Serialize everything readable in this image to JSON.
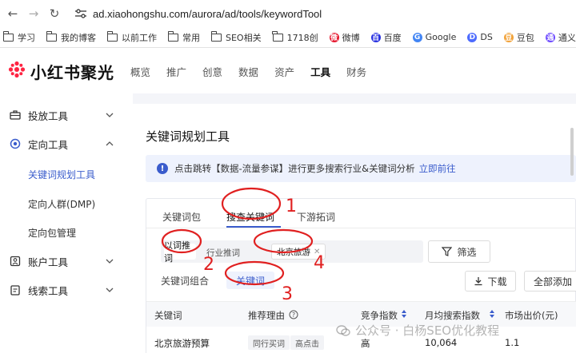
{
  "browser": {
    "url": "ad.xiaohongshu.com/aurora/ad/tools/keywordTool"
  },
  "bookmarks": [
    {
      "label": "学习",
      "icon": "folder-icon"
    },
    {
      "label": "我的博客",
      "icon": "folder-icon"
    },
    {
      "label": "以前工作",
      "icon": "folder-icon"
    },
    {
      "label": "常用",
      "icon": "folder-icon"
    },
    {
      "label": "SEO相关",
      "icon": "folder-icon"
    },
    {
      "label": "1718创",
      "icon": "folder-icon"
    },
    {
      "label": "微博",
      "icon": "weibo-icon"
    },
    {
      "label": "百度",
      "icon": "baidu-icon"
    },
    {
      "label": "Google",
      "icon": "google-icon"
    },
    {
      "label": "DS",
      "icon": "deepseek-icon"
    },
    {
      "label": "豆包",
      "icon": "doubao-icon"
    },
    {
      "label": "通义",
      "icon": "tongyi-icon"
    }
  ],
  "header": {
    "brand": "小红书聚光",
    "menu": [
      "概览",
      "推广",
      "创意",
      "数据",
      "资产",
      "工具",
      "财务"
    ],
    "active_menu": "工具"
  },
  "sidebar": {
    "groups": [
      {
        "label": "投放工具",
        "icon": "briefcase-icon",
        "expanded": false
      },
      {
        "label": "定向工具",
        "icon": "target-icon",
        "expanded": true,
        "items": [
          "关键词规划工具",
          "定向人群(DMP)",
          "定向包管理"
        ],
        "active": "关键词规划工具"
      },
      {
        "label": "账户工具",
        "icon": "account-icon",
        "expanded": false
      },
      {
        "label": "线索工具",
        "icon": "clipboard-icon",
        "expanded": false
      }
    ]
  },
  "main": {
    "title": "关键词规划工具",
    "notice": {
      "text": "点击跳转【数据-流量参谋】进行更多搜索行业&关键词分析",
      "link": "立即前往"
    },
    "tabs": [
      "关键词包",
      "搜查关键词",
      "下游拓词"
    ],
    "active_tab": "搜查关键词",
    "search_mode": {
      "active": "以词推词",
      "other": "行业推词"
    },
    "chip": "北京旅游",
    "filter_label": "筛选",
    "result_tabs": {
      "inactive": "关键词组合",
      "active": "关键词"
    },
    "download_label": "下载",
    "add_all_label": "全部添加",
    "table": {
      "columns": [
        "关键词",
        "推荐理由",
        "竞争指数",
        "月均搜索指数",
        "市场出价(元)"
      ],
      "rows": [
        {
          "keyword": "北京旅游预算",
          "reasons": [
            "同行买词",
            "高点击"
          ],
          "competition": "高",
          "monthly_search": "10,064",
          "bid": "1.1"
        }
      ]
    }
  },
  "annotations": [
    "1",
    "2",
    "3",
    "4"
  ],
  "watermark": "公众号 · 白杨SEO优化教程",
  "colors": {
    "accent": "#3a5ccc",
    "brand_red": "#ff2442",
    "annotation_red": "#e02020"
  }
}
